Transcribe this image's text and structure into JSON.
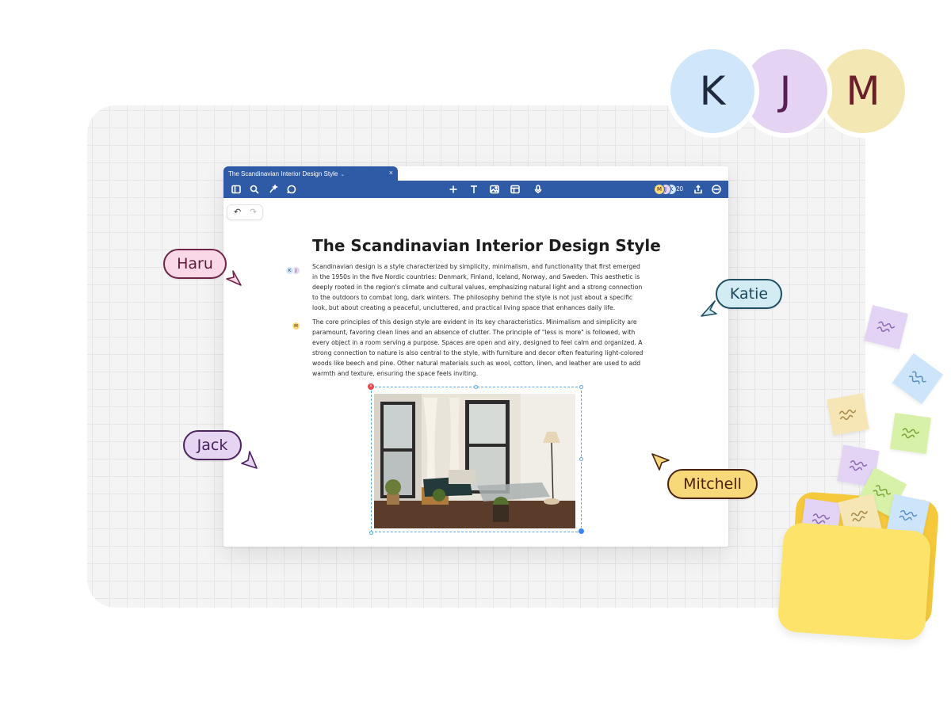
{
  "avatars": [
    {
      "initial": "K",
      "color": "#cfe6fb"
    },
    {
      "initial": "J",
      "color": "#e4d3f2"
    },
    {
      "initial": "M",
      "color": "#f3e7b4"
    }
  ],
  "window": {
    "tab_title": "The Scandinavian Interior Design Style",
    "tab_close": "×",
    "toolbar": {
      "left_icons": [
        "sidebar-icon",
        "search-icon",
        "ai-sparkle-icon",
        "comment-icon"
      ],
      "center_icons": [
        "add-icon",
        "text-icon",
        "image-icon",
        "table-icon",
        "microphone-icon"
      ],
      "collaborators": [
        "M",
        "J",
        "K"
      ],
      "collaborator_count": "20",
      "right_icons": [
        "share-icon",
        "more-icon"
      ]
    },
    "undo_icon": "↶",
    "redo_icon": "↷"
  },
  "document": {
    "title": "The Scandinavian Interior Design Style",
    "paragraph_1": "Scandinavian design is a style characterized by simplicity, minimalism, and functionality that first emerged in the 1950s in the five Nordic countries: Denmark, Finland, Iceland, Norway, and Sweden. This aesthetic is deeply rooted in the region's climate and cultural values, emphasizing natural light and a strong connection to the outdoors to combat long, dark winters. The philosophy behind the style is not just about a specific look, but about creating a peaceful, uncluttered, and practical living space that enhances daily life.",
    "paragraph_2": "The core principles of this design style are evident in its key characteristics. Minimalism and simplicity are paramount, favoring clean lines and an absence of clutter. The principle of \"less is more\" is followed, with every object in a room serving a purpose. Spaces are open and airy, designed to feel calm and organized. A strong connection to nature is also central to the style, with furniture and decor often featuring light-colored woods like beech and pine. Other natural materials such as wool, cotton, linen, and leather are used to add warmth and texture, ensuring the space feels inviting.",
    "para1_markers": [
      "K",
      "J"
    ],
    "para2_markers": [
      "M"
    ]
  },
  "cursors": {
    "haru": "Haru",
    "katie": "Katie",
    "jack": "Jack",
    "mitchell": "Mitchell"
  },
  "colors": {
    "toolbar": "#2e5aa6",
    "haru": "#fbd8e7",
    "katie": "#d3ecf4",
    "jack": "#e5d4f2",
    "mitchell": "#f7d97a",
    "folder": "#fde36a"
  }
}
